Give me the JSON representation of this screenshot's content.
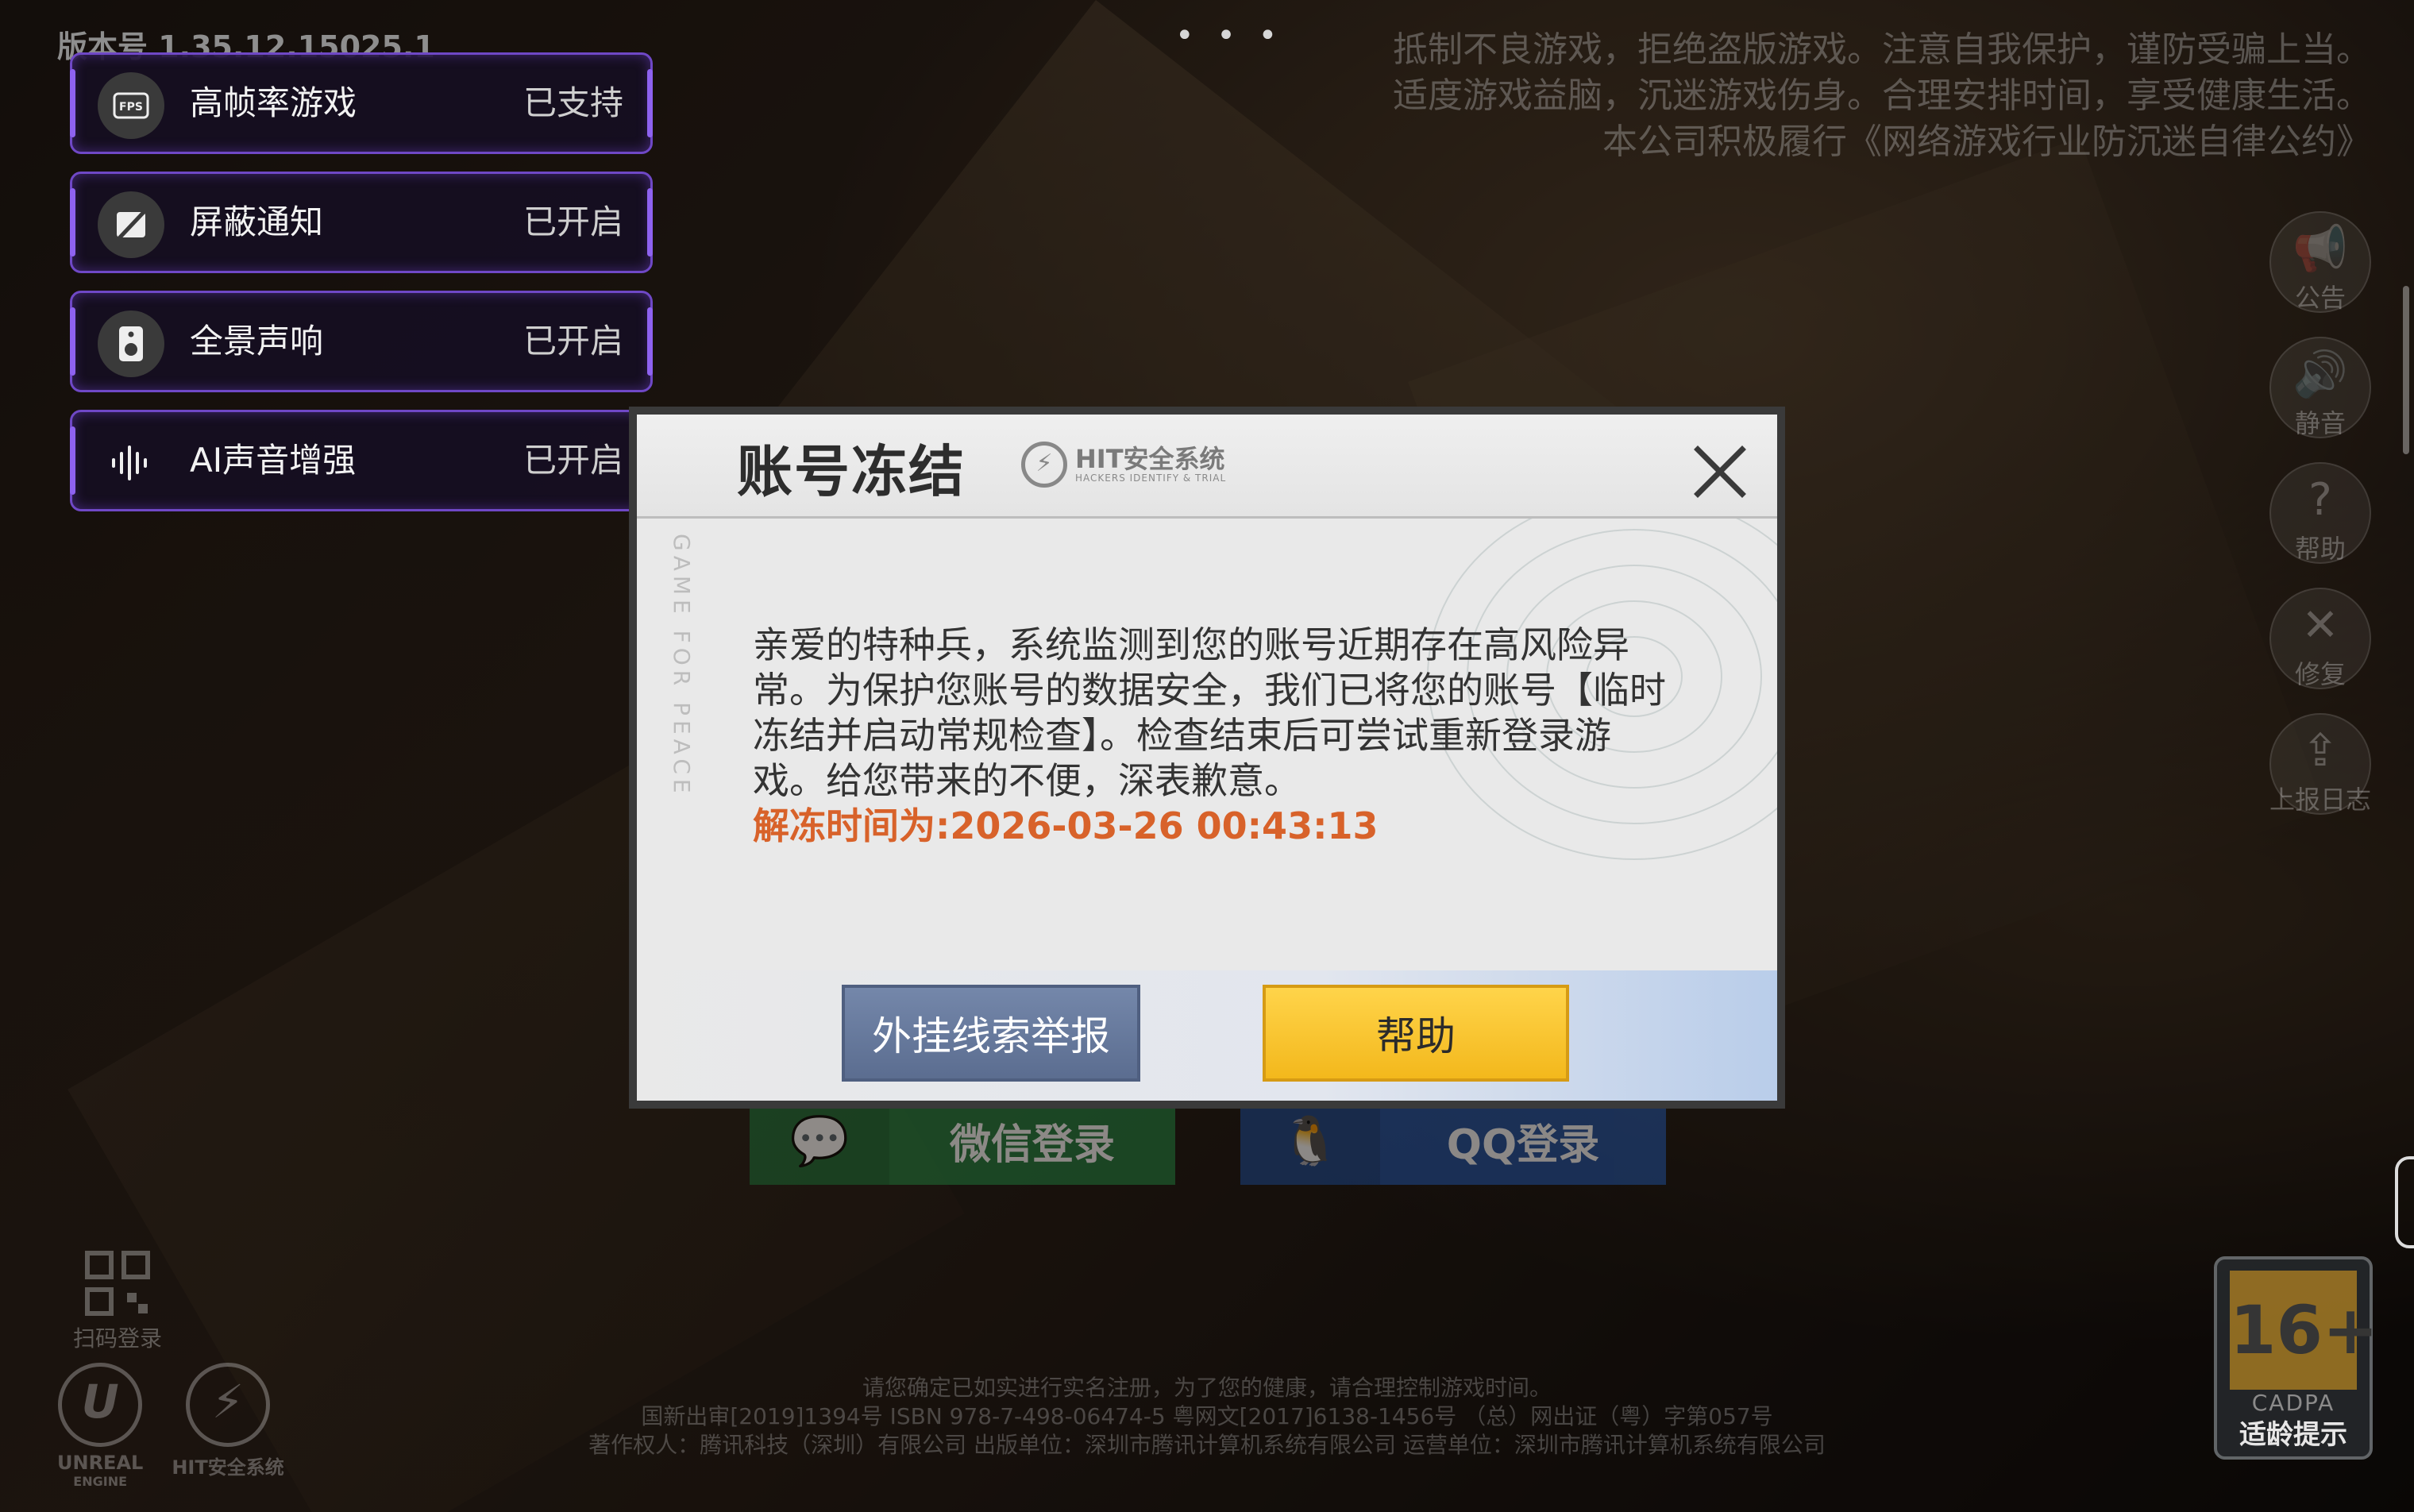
{
  "version_label": "版本号 1.35.12.15025.1",
  "more_dots": "• • •",
  "notice_lines": [
    "抵制不良游戏，拒绝盗版游戏。注意自我保护，谨防受骗上当。",
    "适度游戏益脑，沉迷游戏伤身。合理安排时间，享受健康生活。",
    "本公司积极履行《网络游戏行业防沉迷自律公约》"
  ],
  "cards": [
    {
      "name": "高帧率游戏",
      "status": "已支持",
      "icon": "fps-icon",
      "icon_text": "FPS"
    },
    {
      "name": "屏蔽通知",
      "status": "已开启",
      "icon": "notification-block-icon"
    },
    {
      "name": "全景声响",
      "status": "已开启",
      "icon": "speaker-icon"
    },
    {
      "name": "AI声音增强",
      "status": "已开启",
      "icon": "audio-wave-icon"
    }
  ],
  "side_tools": [
    {
      "label": "公告",
      "icon": "megaphone-icon"
    },
    {
      "label": "静音",
      "icon": "volume-icon"
    },
    {
      "label": "帮助",
      "icon": "help-icon"
    },
    {
      "label": "修复",
      "icon": "wrench-icon"
    },
    {
      "label": "上报日志",
      "icon": "upload-log-icon"
    }
  ],
  "login": {
    "wechat_label": "微信登录",
    "qq_label": "QQ登录",
    "qr_label": "扫码登录"
  },
  "logos": {
    "unreal_label": "UNREAL",
    "unreal_sub": "ENGINE",
    "hit_label": "HIT安全系统"
  },
  "legal_lines": [
    "请您确定已如实进行实名注册，为了您的健康，请合理控制游戏时间。",
    "国新出审[2019]1394号   ISBN 978-7-498-06474-5   粤网文[2017]6138-1456号 （总）网出证（粤）字第057号",
    "著作权人：腾讯科技（深圳）有限公司   出版单位：深圳市腾讯计算机系统有限公司   运营单位：深圳市腾讯计算机系统有限公司"
  ],
  "age_badge": {
    "number": "16+",
    "org": "CADPA",
    "tip": "适龄提示"
  },
  "modal": {
    "title": "账号冻结",
    "brand": "HIT安全系统",
    "brand_sub": "HACKERS IDENTIFY & TRIAL",
    "side_text": "GAME FOR PEACE",
    "message": "亲爱的特种兵，系统监测到您的账号近期存在高风险异常。为保护您账号的数据安全，我们已将您的账号【临时冻结并启动常规检查】。检查结束后可尝试重新登录游戏。给您带来的不便，深表歉意。",
    "unfreeze_text": "解冻时间为:2026-03-26 00:43:13",
    "report_button": "外挂线索举报",
    "help_button": "帮助"
  }
}
